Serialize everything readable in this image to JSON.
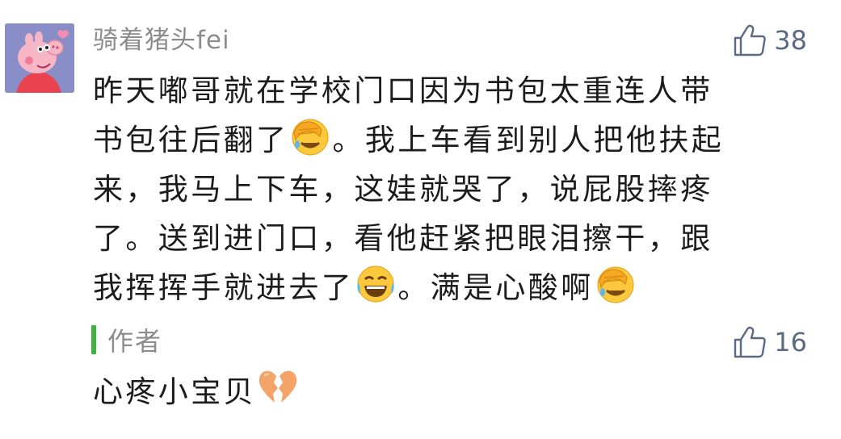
{
  "comment": {
    "username": "骑着猪头fei",
    "avatar_icon": "peppa-pig-avatar",
    "likes": "38",
    "lines": [
      [
        "昨天嘟哥就在学校门口因为书包太重连人带"
      ],
      [
        "书包往后翻了",
        "。我上车看到别人把他扶起"
      ],
      [
        "来，我马上下车，这娃就哭了，说屁股摔疼"
      ],
      [
        "了。送到进门口，看他赶紧把眼泪擦干，跟"
      ],
      [
        "我挥挥手就进去了",
        "。满是心酸啊"
      ]
    ],
    "emojis": {
      "facepalm": "face-with-hand-over-eyes-icon",
      "laughing": "face-with-tears-of-joy-icon",
      "broken_heart": "broken-heart-icon"
    }
  },
  "reply": {
    "label": "作者",
    "likes": "16",
    "text": "心疼小宝贝"
  },
  "colors": {
    "username": "#8c8c8c",
    "like": "#5b6a82",
    "author_bar": "#3fb43c",
    "avatar_bg": "#8a8ec8"
  }
}
